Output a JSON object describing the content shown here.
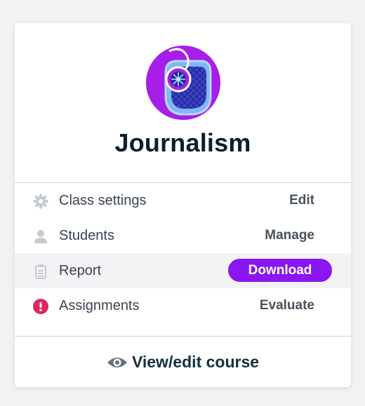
{
  "course": {
    "title": "Journalism",
    "logo_icon": "journalism-course-logo"
  },
  "rows": [
    {
      "icon": "gear-icon",
      "label": "Class settings",
      "action": "Edit"
    },
    {
      "icon": "person-icon",
      "label": "Students",
      "action": "Manage"
    },
    {
      "icon": "clipboard-icon",
      "label": "Report",
      "action": "Download"
    },
    {
      "icon": "alert-icon",
      "label": "Assignments",
      "action": "Evaluate"
    }
  ],
  "footer": {
    "icon": "eye-icon",
    "label": "View/edit course"
  },
  "colors": {
    "accent": "#8a16f2",
    "alert": "#e0245e",
    "title": "#0e1e2b",
    "icon_grey": "#c4ccd3"
  }
}
